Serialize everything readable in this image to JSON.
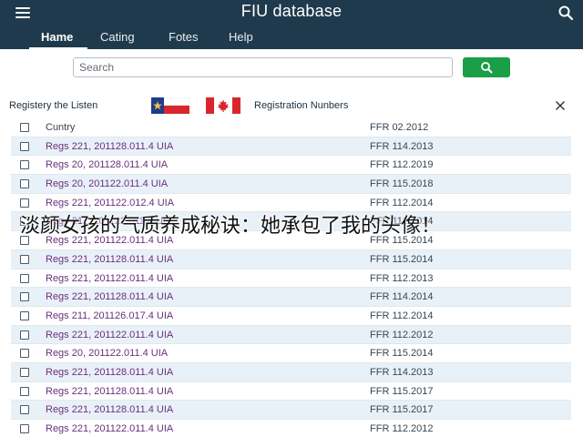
{
  "header": {
    "title": "FIU database"
  },
  "tabs": [
    {
      "label": "Hame",
      "active": true
    },
    {
      "label": "Cating",
      "active": false
    },
    {
      "label": "Fotes",
      "active": false
    },
    {
      "label": "Help",
      "active": false
    }
  ],
  "search": {
    "placeholder": "Search"
  },
  "section": {
    "title": "Registery the Listen",
    "registration_label": "Registration Nunbers"
  },
  "table": {
    "header": {
      "name": "Cuntry",
      "number": "FFR 02.2012"
    },
    "rows": [
      {
        "name": "Regs 221, 201128.011.4 UIA",
        "number": "FFR 114.2013"
      },
      {
        "name": "Regs 20, 201128.011.4 UIA",
        "number": "FFR 112.2019"
      },
      {
        "name": "Regs 20, 201122.011.4 UIA",
        "number": "FFR 115.2018"
      },
      {
        "name": "Regs 221, 201122.012.4 UIA",
        "number": "FFR 112.2014"
      },
      {
        "name": "Regs 211, 201122.011.4 UIA",
        "number": "FFR 112.2014"
      },
      {
        "name": "Regs 221, 201122.011.4 UIA",
        "number": "FFR 115.2014"
      },
      {
        "name": "Regs 221, 201128.011.4 UIA",
        "number": "FFR 115.2014"
      },
      {
        "name": "Regs 221, 201122.011.4 UIA",
        "number": "FFR 112.2013"
      },
      {
        "name": "Regs 221, 201128.011.4 UIA",
        "number": "FFR 114.2014"
      },
      {
        "name": "Regs 211, 201126.017.4 UIA",
        "number": "FFR 112.2014"
      },
      {
        "name": "Regs 221, 201122.011.4 UIA",
        "number": "FFR 112.2012"
      },
      {
        "name": "Regs 20, 201122.011.4 UIA",
        "number": "FFR 115.2014"
      },
      {
        "name": "Regs 221, 201128.011.4 UIA",
        "number": "FFR 114.2013"
      },
      {
        "name": "Regs 221, 201128.011.4 UIA",
        "number": "FFR 115.2017"
      },
      {
        "name": "Regs 221, 201128.011.4 UIA",
        "number": "FFR 115.2017"
      },
      {
        "name": "Regs 221, 201122.011.4 UIA",
        "number": "FFR 112.2012"
      }
    ]
  },
  "overlay": {
    "caption": "淡颜女孩的气质养成秘诀：她承包了我的头像！"
  },
  "colors": {
    "topbar": "#1f3a4c",
    "search_button": "#1a9e48",
    "row_alt": "#e9f1f8",
    "link_text": "#6a2f7c"
  }
}
